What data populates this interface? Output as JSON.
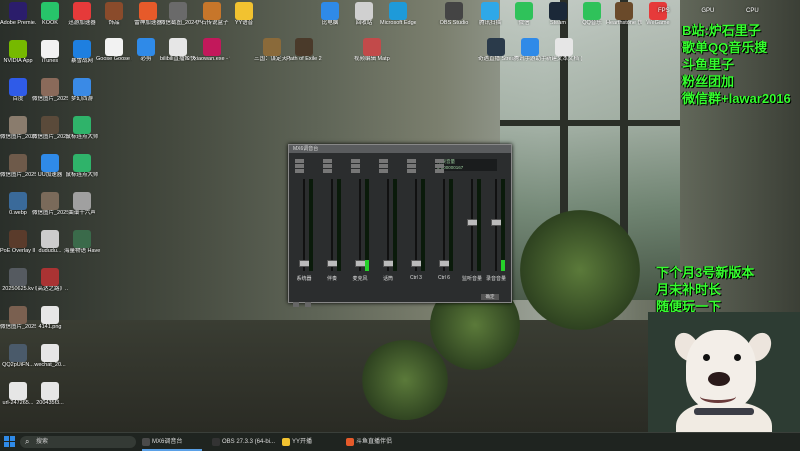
{
  "desktop": {
    "icons_col1": [
      {
        "label": "Adobe Premie...",
        "color": "#2b1d6b"
      },
      {
        "label": "NVIDIA App",
        "color": "#76b900"
      },
      {
        "label": "百度",
        "color": "#2f5be8"
      },
      {
        "label": "微信图片_20250...",
        "color": "#8a7c6d"
      },
      {
        "label": "微信图片_2025...",
        "color": "#6e5a4a"
      },
      {
        "label": "0.webp",
        "color": "#3a6a9a"
      },
      {
        "label": "PoE Overlay II Standal...",
        "color": "#5a3b2b"
      },
      {
        "label": "20250625.kv",
        "color": "#555a60"
      },
      {
        "label": "微信图片_2025062...",
        "color": "#7a6050"
      },
      {
        "label": "QQ2pUiFN...",
        "color": "#4a5a6a"
      },
      {
        "label": "url-247265...",
        "color": "#e6e6e6"
      }
    ],
    "icons_col2": [
      {
        "label": "KOOK",
        "color": "#27c46a"
      },
      {
        "label": "iTunes",
        "color": "#f2f2f2"
      },
      {
        "label": "微信图片_2025072...",
        "color": "#8a6a5a"
      },
      {
        "label": "微信图片_2025072...",
        "color": "#5a4a3a"
      },
      {
        "label": "UU加速器",
        "color": "#2f8ae8"
      },
      {
        "label": "微信图片_2025071...",
        "color": "#7a6a5a"
      },
      {
        "label": "dududu...",
        "color": "#cccccc"
      },
      {
        "label": "《高达之路》...",
        "color": "#aa3333"
      },
      {
        "label": "4141.png",
        "color": "#e6e6e6"
      },
      {
        "label": "wechat_20...",
        "color": "#e6e6e6"
      },
      {
        "label": "200435f3...",
        "color": "#e6e6e6"
      }
    ],
    "icons_col3": [
      {
        "label": "迅游加速器",
        "color": "#e63a3a"
      },
      {
        "label": "暴雪战网",
        "color": "#1e7fe0"
      },
      {
        "label": "梦幻西游",
        "color": "#3a8ae6"
      },
      {
        "label": "鼠标连点大师",
        "color": "#2fb36a"
      },
      {
        "label": "鼠标连点大师",
        "color": "#2fb36a"
      },
      {
        "label": "曲谱十六声",
        "color": "#a0a0a0"
      },
      {
        "label": "海量物语 Havendock",
        "color": "#3a6a4a"
      },
      {
        "label": "",
        "color": "transparent"
      },
      {
        "label": "",
        "color": "transparent"
      },
      {
        "label": "",
        "color": "transparent"
      },
      {
        "label": "",
        "color": "transparent"
      }
    ],
    "icons_row_top": [
      {
        "label": "饰品",
        "color": "#8a4b2b"
      },
      {
        "label": "雷神加速器",
        "color": "#e65a2a"
      },
      {
        "label": "微信截图_2024071...",
        "color": "#6a6a6a"
      },
      {
        "label": "炉石传说盒子",
        "color": "#c7762a"
      },
      {
        "label": "YY语音",
        "color": "#f2c230"
      },
      {
        "label": "比电脑",
        "color": "#2f8ae8"
      },
      {
        "label": "回收站",
        "color": "#d0d0d0"
      },
      {
        "label": "Microsoft Edge",
        "color": "#1e9ad9"
      },
      {
        "label": "OBS Studio",
        "color": "#444444"
      },
      {
        "label": "腾讯扫描",
        "color": "#2fa8e8"
      },
      {
        "label": "微信",
        "color": "#2fc25a"
      },
      {
        "label": "Steam",
        "color": "#1b2838"
      },
      {
        "label": "QQ音乐",
        "color": "#2fc25a"
      },
      {
        "label": "Hearthstone 快速方式",
        "color": "#6a4a2a"
      },
      {
        "label": "WeGame",
        "color": "#e63a3a"
      }
    ],
    "icons_row_second": [
      {
        "label": "Goose Goose Duck",
        "color": "#f2f2f2"
      },
      {
        "label": "必剪",
        "color": "#2f8ae8"
      },
      {
        "label": "bilibili直播姬快捷方式",
        "color": "#e6e6e6"
      },
      {
        "label": "xiaowan.exe - 快捷方式",
        "color": "#c2185b"
      },
      {
        "label": "三国：谋定天下",
        "color": "#8a6a3a"
      },
      {
        "label": "Path of Exile 2",
        "color": "#4a3a2a"
      },
      {
        "label": "",
        "color": "transparent"
      },
      {
        "label": "视频编辑 Matplotlib...",
        "color": "#c24a4a"
      },
      {
        "label": "",
        "color": "transparent"
      },
      {
        "label": "奇遇直播 Streamlit...",
        "color": "#2a3a4a"
      },
      {
        "label": "腾讯手游助手",
        "color": "#2f8ae8"
      },
      {
        "label": "新建文本文档 (8).txt",
        "color": "#e6e6e6"
      }
    ]
  },
  "overlay_top": [
    "B站:炉石里子",
    "歌单QQ音乐搜",
    "斗鱼里子",
    "粉丝团加",
    "微信群+lawar2016"
  ],
  "overlay_bottom": [
    "下个月3号新版本",
    "月末补时长",
    "随便玩一下"
  ],
  "perf_overlay": {
    "fps": "FPS",
    "gpu": "GPU",
    "cpu": "CPU"
  },
  "mixer": {
    "title": "MX6调音台",
    "lcd_lines": [
      "效果音量",
      "0  000000167"
    ],
    "ok_label": "确定",
    "channels": [
      {
        "name": "系统器",
        "level": 0.0,
        "knob": 0.08
      },
      {
        "name": "伴奏",
        "level": 0.0,
        "knob": 0.08
      },
      {
        "name": "麦克风",
        "level": 0.12,
        "knob": 0.08
      },
      {
        "name": "话筒",
        "level": 0.0,
        "knob": 0.08
      },
      {
        "name": "Ctrl 3",
        "level": 0.0,
        "knob": 0.08
      },
      {
        "name": "Ctrl 6",
        "level": 0.0,
        "knob": 0.08
      },
      {
        "name": "监听音量",
        "level": 0.0,
        "knob": 0.55
      },
      {
        "name": "录音音量",
        "level": 0.12,
        "knob": 0.55
      }
    ]
  },
  "taskbar": {
    "search_placeholder": "搜索",
    "items": [
      {
        "label": "MX6调音台",
        "color": "#4a4a4a",
        "active": true
      },
      {
        "label": "OBS 27.3.3 (64-bi...",
        "color": "#333333",
        "active": false
      },
      {
        "label": "YY开播",
        "color": "#f2c230",
        "active": false
      },
      {
        "label": "斗鱼直播伴侣",
        "color": "#e65a2a",
        "active": false
      }
    ]
  }
}
